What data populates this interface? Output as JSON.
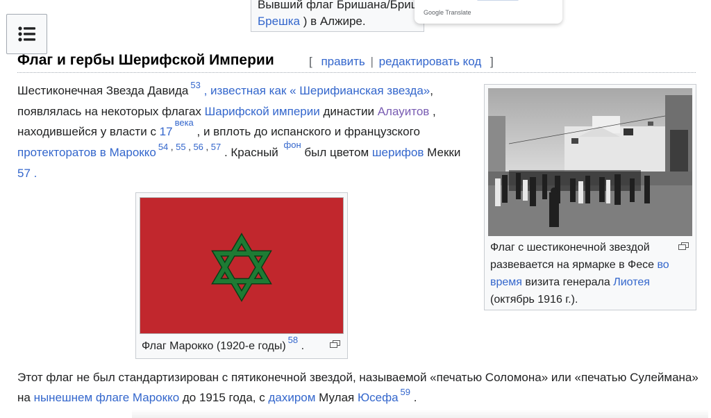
{
  "top_fragment": {
    "line1": "Вывший флаг Бришана/Бриш",
    "link": "Брешка",
    "line2_rest": " ) в Алжире."
  },
  "translate_popup": {
    "brand": "Google Translate"
  },
  "toc": {
    "icon": "list-icon"
  },
  "heading": {
    "title": "Флаг и гербы Шерифской Империи",
    "edit_open": "[",
    "edit_label": "править",
    "edit_sep": "|",
    "edit_code_label": "редактировать код",
    "edit_close": "]"
  },
  "para1": {
    "t1": "Шестиконечная Звезда Давида",
    "ref53": "53",
    "l1": ", известная как «  Шерифианская звезда»",
    "t2": ", появлялась на некоторых флагах ",
    "l2": "Шарифской империи",
    "t3": " династии ",
    "l3": "Алауитов",
    "t4": " , находившейся у власти с ",
    "l4": "17",
    "sup_century": "века",
    "t5": " , и вплоть до испанского и французского ",
    "l5": "протекторатов в Марокко",
    "ref54": "54",
    "comma1": " , ",
    "ref55": "55",
    "comma2": " , ",
    "ref56": "56",
    "comma3": " , ",
    "ref57": "57",
    "t6": " . Красный ",
    "sup_fon": "фон",
    "t7": " был цветом ",
    "l6": "шерифов",
    "t8": " Мекки ",
    "l7": "57 ."
  },
  "thumb_right": {
    "c1": "Флаг с шестиконечной звездой развевается на ярмарке в Фесе ",
    "link1": "во время",
    "c2": " визита генерала ",
    "link2": "Лиотея",
    "c3": " (октябрь 1916 г.)."
  },
  "thumb_center": {
    "caption": "Флаг Марокко (1920-е годы)",
    "ref": "58",
    "end": " ."
  },
  "para2": {
    "t1": "Этот флаг не был стандартизирован с пятиконечной звездой, называемой «печатью Соломона» или «печатью Сулеймана» на ",
    "l1": "нынешнем флаге Марокко",
    "t2": " до 1915 года, с ",
    "l2": "дахиром",
    "t3": " Мулая ",
    "l3": "Юсефа",
    "ref59": "59",
    "t4": " ."
  },
  "colors": {
    "link": "#3366cc",
    "visited_link": "#795cb2",
    "flag_red": "#c1272d",
    "star_green": "#1e7b34"
  }
}
